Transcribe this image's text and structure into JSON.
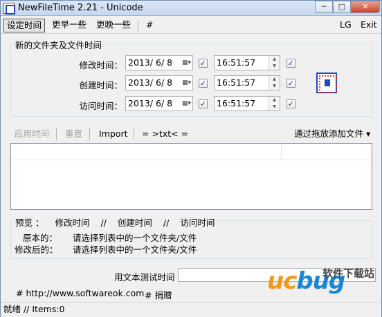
{
  "window": {
    "title": "NewFileTime 2.21 - Unicode",
    "minimize_glyph": "─",
    "maximize_glyph": "□",
    "close_glyph": "✕"
  },
  "menu": {
    "items": [
      "设定时间",
      "更早一些",
      "更晚一些",
      "#"
    ],
    "right_items": [
      "LG",
      "Exit"
    ]
  },
  "time_group": {
    "title": "新的文件夹及文件时间",
    "rows": [
      {
        "label": "修改时间：",
        "date": "2013/ 6/ 8",
        "time": "16:51:57",
        "date_checked": true,
        "time_checked": true
      },
      {
        "label": "创建时间：",
        "date": "2013/ 6/ 8",
        "time": "16:51:57",
        "date_checked": true,
        "time_checked": true
      },
      {
        "label": "访问时间：",
        "date": "2013/ 6/ 8",
        "time": "16:51:57",
        "date_checked": true,
        "time_checked": true
      }
    ],
    "date_dropdown_glyph": "▦▾",
    "check_glyph": "✓",
    "spin_up": "▲",
    "spin_down": "▼"
  },
  "toolbar": {
    "apply_time": "应用时间",
    "reset": "重置",
    "import": "Import",
    "txt": "= >txt< =",
    "drag_add": "通过拖放添加文件 ▾"
  },
  "preview": {
    "header": [
      "预览 ：",
      "修改时间",
      "//",
      "创建时间",
      "//",
      "访问时间"
    ],
    "original_label": "原本的：",
    "original_value": "请选择列表中的一个文件夹/文件",
    "modified_label": "修改后的：",
    "modified_value": "请选择列表中的一个文件夹/文件"
  },
  "text_test": {
    "label": "用文本测试时间",
    "value": ""
  },
  "footer_links": {
    "website": "# http://www.softwareok.com",
    "donate": "# 捐赠"
  },
  "status": {
    "text": "就绪 // Items:0"
  },
  "watermark": {
    "logo_u": "uc",
    "logo_b": "bug",
    "cn": "软件下载站"
  }
}
